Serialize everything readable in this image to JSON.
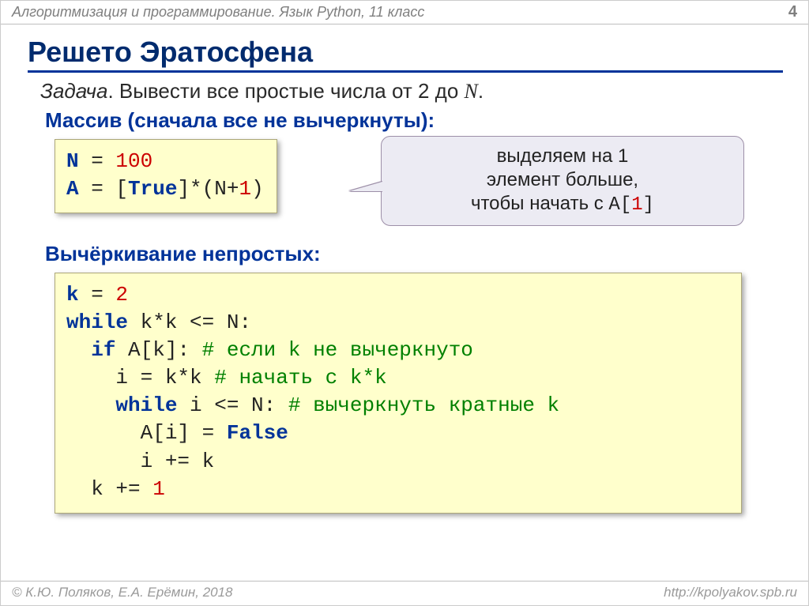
{
  "header": {
    "course": "Алгоритмизация и программирование. Язык Python, 11 класс",
    "page": "4"
  },
  "title": "Решето Эратосфена",
  "task": {
    "label": "Задача",
    "text": ". Вывести все простые числа от 2 до ",
    "var": "N",
    "dot": "."
  },
  "subheads": {
    "array": "Массив (сначала все не вычеркнуты):",
    "strike": "Вычёркивание непростых:"
  },
  "code1": {
    "l1a": "N",
    "l1b": " = ",
    "l1c": "100",
    "l2a": "A",
    "l2b": " = [",
    "l2c": "True",
    "l2d": "]*(N+",
    "l2e": "1",
    "l2f": ")"
  },
  "callout": {
    "line1": "выделяем на 1",
    "line2": "элемент больше,",
    "line3a": "чтобы начать с ",
    "line3mono": "A[",
    "line3num": "1",
    "line3end": "]"
  },
  "code2": {
    "l1a": "k",
    "l1b": " = ",
    "l1c": "2",
    "l2a": "while",
    "l2b": " k*k <= N:",
    "l3a": "  ",
    "l3b": "if",
    "l3c": " A[k]: ",
    "l3d": "# если k не вычеркнуто",
    "l4a": "    i = k*k ",
    "l4b": "# начать с k*k",
    "l5a": "    ",
    "l5b": "while",
    "l5c": " i <= N: ",
    "l5d": "# вычеркнуть кратные k",
    "l6a": "      A[i] = ",
    "l6b": "False",
    "l7": "      i += k",
    "l8a": "  k += ",
    "l8b": "1"
  },
  "footer": {
    "left": "© К.Ю. Поляков, Е.А. Ерёмин, 2018",
    "right": "http://kpolyakov.spb.ru"
  }
}
